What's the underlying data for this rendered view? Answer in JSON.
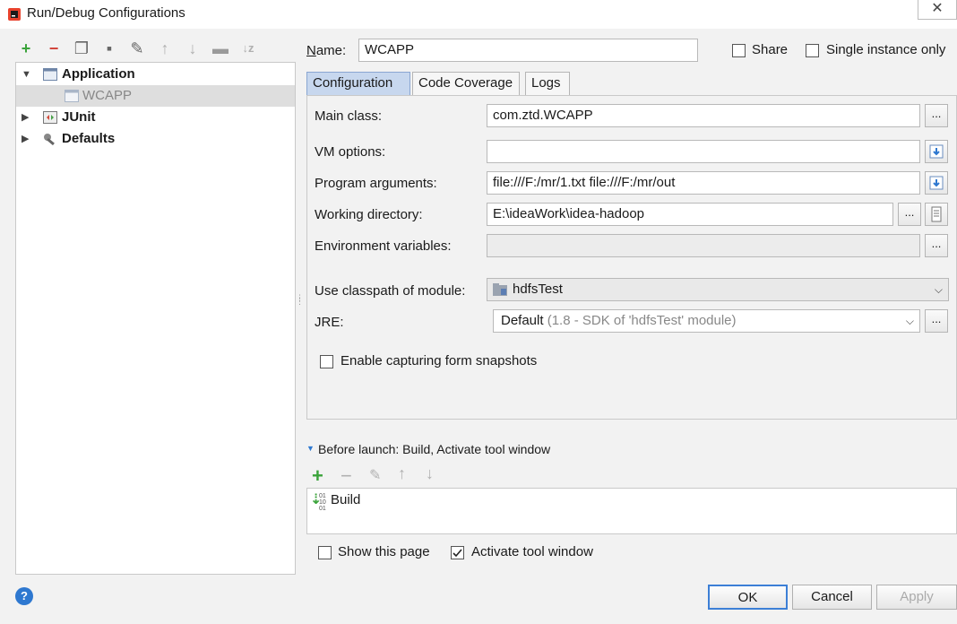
{
  "window": {
    "title": "Run/Debug Configurations",
    "close_glyph": "✕"
  },
  "left_toolbar": [
    {
      "name": "add-icon",
      "glyph": "+",
      "color": "#3aa33a"
    },
    {
      "name": "remove-icon",
      "glyph": "−",
      "color": "#d2453b"
    },
    {
      "name": "copy-icon",
      "glyph": "❐",
      "color": "#666666"
    },
    {
      "name": "save-icon",
      "glyph": "▪",
      "color": "#666666"
    },
    {
      "name": "edit-defaults-icon",
      "glyph": "✎",
      "color": "#666666"
    },
    {
      "name": "move-up-icon",
      "glyph": "↑",
      "color": "#b0b0b0"
    },
    {
      "name": "move-down-icon",
      "glyph": "↓",
      "color": "#b0b0b0"
    },
    {
      "name": "folder-icon",
      "glyph": "▬",
      "color": "#9a9a9a"
    },
    {
      "name": "sort-icon",
      "glyph": "↓z",
      "color": "#b0b0b0"
    }
  ],
  "tree": {
    "application": "Application",
    "wcapp": "WCAPP",
    "junit": "JUnit",
    "defaults": "Defaults"
  },
  "name_label": "Name:",
  "name_value": "WCAPP",
  "share_label": "Share",
  "single_instance_label": "Single instance only",
  "tabs": {
    "configuration": "Configuration",
    "coverage": "Code Coverage",
    "logs": "Logs"
  },
  "form": {
    "main_class_label": "Main class:",
    "main_class_value": "com.ztd.WCAPP",
    "vm_options_label": "VM options:",
    "vm_options_value": "",
    "program_args_label": "Program arguments:",
    "program_args_value": "file:///F:/mr/1.txt file:///F:/mr/out",
    "working_dir_label": "Working directory:",
    "working_dir_value": "E:\\ideaWork\\idea-hadoop",
    "env_vars_label": "Environment variables:",
    "env_vars_value": "",
    "classpath_label": "Use classpath of module:",
    "classpath_value": "hdfsTest",
    "jre_label": "JRE:",
    "jre_value": "Default",
    "jre_detail": "(1.8 - SDK of 'hdfsTest' module)",
    "snapshots_label": "Enable capturing form snapshots",
    "ellipsis": "..."
  },
  "before_launch": {
    "header": "Before launch: Build, Activate tool window",
    "item": "Build"
  },
  "show_page_label": "Show this page",
  "activate_tool_label": "Activate tool window",
  "buttons": {
    "ok": "OK",
    "cancel": "Cancel",
    "apply": "Apply",
    "help": "?"
  },
  "colors": {
    "selection": "#dedede",
    "tab_active": "#c7d7ee",
    "accent": "#2e78d0"
  }
}
